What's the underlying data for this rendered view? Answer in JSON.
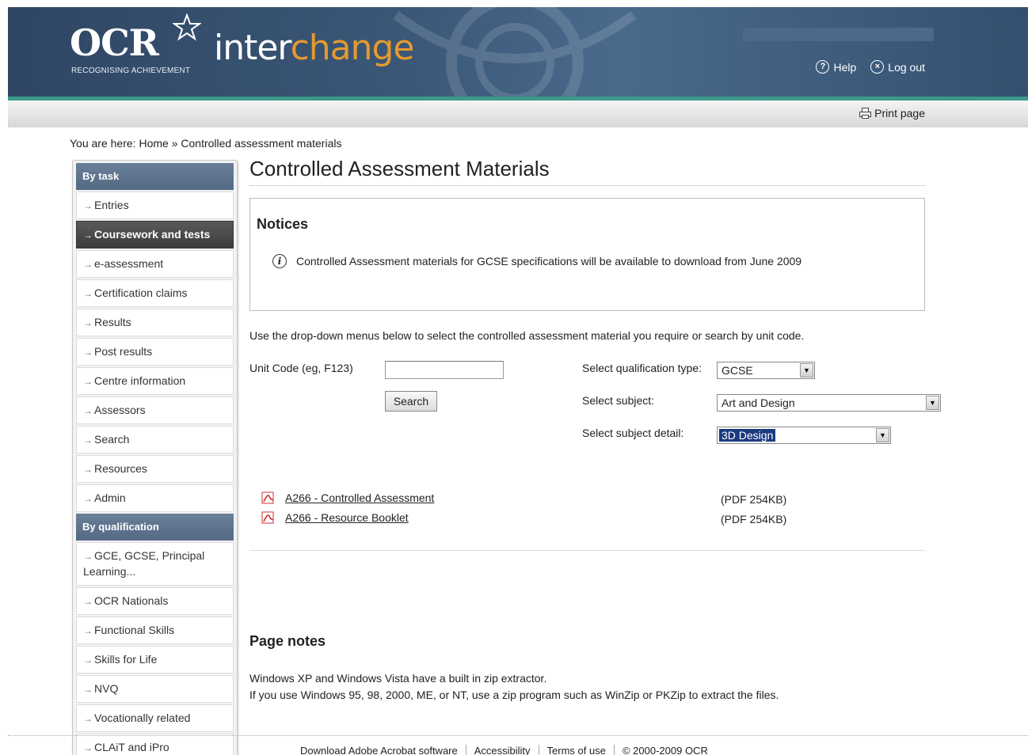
{
  "header": {
    "logo_text": "OCR",
    "logo_tagline": "RECOGNISING ACHIEVEMENT",
    "brand_white": "inter",
    "brand_orange": "change",
    "help_label": "Help",
    "logout_label": "Log out",
    "colors": {
      "bar": "#3b5878",
      "stripe": "#3b9a8a",
      "brand_orange": "#e49a2e"
    }
  },
  "toolbar": {
    "print_label": "Print page"
  },
  "breadcrumb": {
    "prefix": "You are here:",
    "home": "Home",
    "separator": "»",
    "current": "Controlled assessment materials"
  },
  "sidebar": {
    "by_task_heading": "By task",
    "task_items": [
      "Entries",
      "Coursework and tests",
      "e-assessment",
      "Certification claims",
      "Results",
      "Post results",
      "Centre information",
      "Assessors",
      "Search",
      "Resources",
      "Admin"
    ],
    "active_item": "Coursework and tests",
    "by_qualification_heading": "By qualification",
    "qual_items": [
      "GCE, GCSE, Principal Learning...",
      "OCR Nationals",
      "Functional Skills",
      "Skills for Life",
      "NVQ",
      "Vocationally related",
      "CLAiT and iPro"
    ]
  },
  "main": {
    "title": "Controlled Assessment Materials",
    "notices_heading": "Notices",
    "notice_text": "Controlled Assessment materials for GCSE specifications will be available to download from June 2009",
    "intro": "Use the drop-down menus below to select the controlled assessment material you require or search by unit code.",
    "unit_code_label": "Unit Code (eg, F123)",
    "unit_code_value": "",
    "search_button": "Search",
    "qual_type_label": "Select qualification type:",
    "qual_type_value": "GCSE",
    "subject_label": "Select subject:",
    "subject_value": "Art and Design",
    "subject_detail_label": "Select subject detail:",
    "subject_detail_value": "3D Design",
    "files": [
      {
        "name": "A266 - Controlled Assessment",
        "size": "(PDF 254KB)"
      },
      {
        "name": "A266 - Resource Booklet",
        "size": "(PDF 254KB)"
      }
    ],
    "notes_heading": "Page notes",
    "notes": [
      "Windows XP and Windows Vista have a built in zip extractor.",
      "If you use Windows 95, 98, 2000, ME, or NT, use a zip program such as WinZip or PKZip to extract the files."
    ]
  },
  "footer": {
    "links": [
      "Download Adobe Acrobat software",
      "Accessibility",
      "Terms of use",
      "© 2000-2009 OCR"
    ]
  }
}
